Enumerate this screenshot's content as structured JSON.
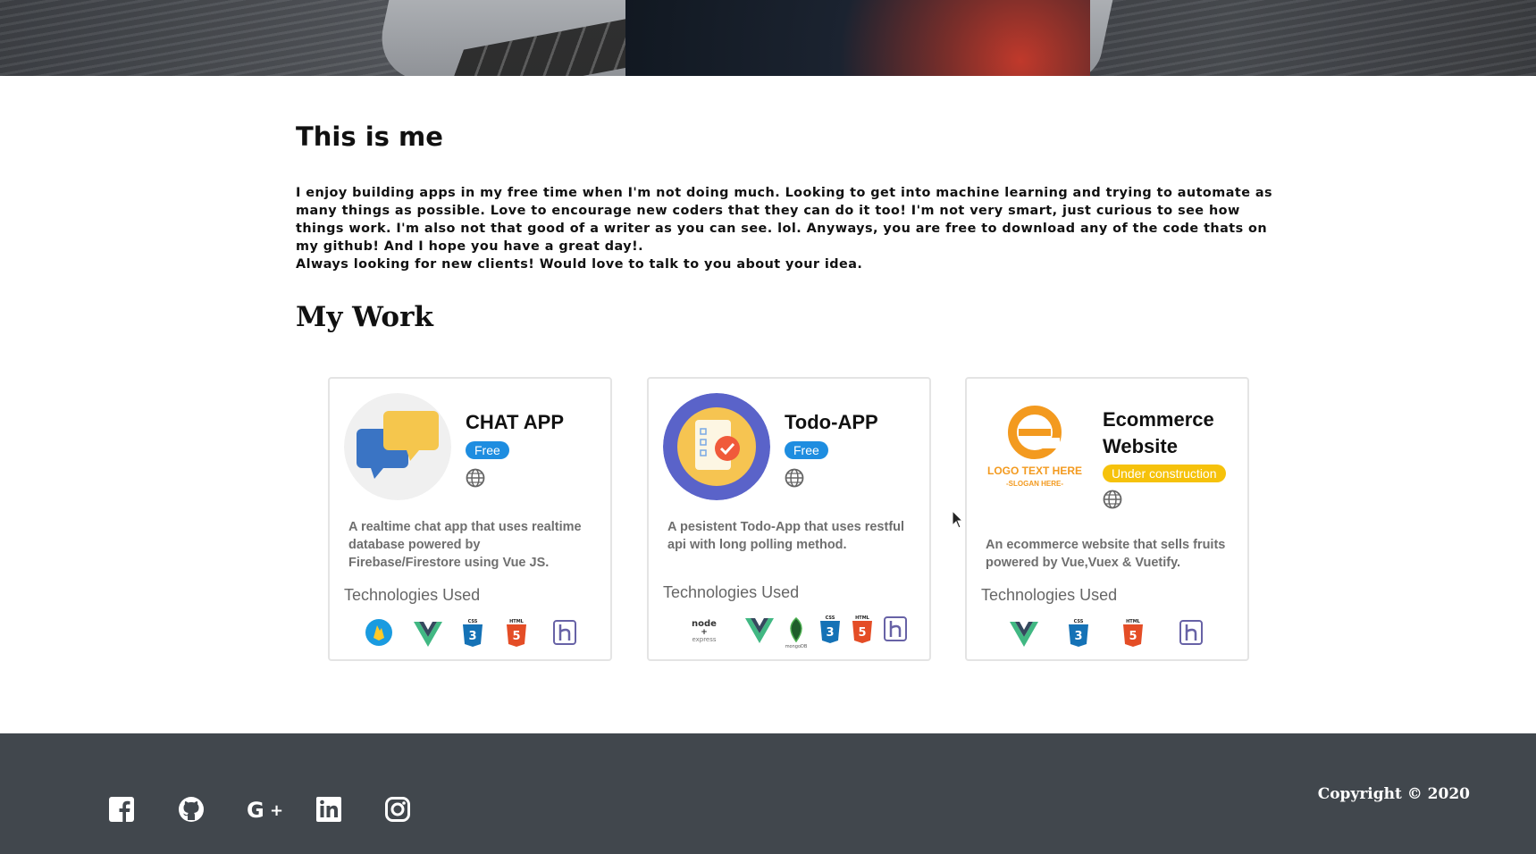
{
  "about": {
    "title": "This is me",
    "paragraph1": "I enjoy building apps in my free time when I'm not doing much. Looking to get into machine learning and trying to automate as many things as possible. Love to encourage new coders that they can do it too! I'm not very smart, just curious to see how things work. I'm also not that good of a writer as you can see. lol. Anyways, you are free to download any of the code thats on my github! And I hope you have a great day!.",
    "paragraph2": "Always looking for new clients! Would love to talk to you about your idea."
  },
  "work": {
    "title": "My Work",
    "tech_label": "Technologies Used",
    "projects": [
      {
        "name": "CHAT APP",
        "badge": "Free",
        "description": "A realtime chat app that uses realtime database powered by Firebase/Firestore using Vue JS.",
        "image": "chat-bubbles-icon",
        "technologies": [
          "firebase-icon",
          "vue-icon",
          "css3-icon",
          "html5-icon",
          "heroku-icon"
        ]
      },
      {
        "name": "Todo-APP",
        "badge": "Free",
        "description": "A pesistent Todo-App that uses restful api with long polling method.",
        "image": "todo-checklist-icon",
        "technologies": [
          "node-express-icon",
          "vue-icon",
          "mongodb-icon",
          "css3-icon",
          "html5-icon",
          "heroku-icon"
        ]
      },
      {
        "name": "Ecommerce Website",
        "badge": "Under construction",
        "description": "An ecommerce website that sells fruits powered by Vue,Vuex & Vuetify.",
        "image": "logo-placeholder",
        "logo_text": "LOGO TEXT HERE",
        "logo_slogan": "-SLOGAN HERE-",
        "technologies": [
          "vue-icon",
          "css3-icon",
          "html5-icon",
          "heroku-icon"
        ]
      }
    ]
  },
  "footer": {
    "social": [
      "facebook-icon",
      "github-icon",
      "google-plus-icon",
      "linkedin-icon",
      "instagram-icon"
    ],
    "copyright": "Copyright © 2020"
  },
  "colors": {
    "footer_bg": "#41474d",
    "badge_free": "#1e8de0",
    "badge_wip": "#f6c20b"
  }
}
